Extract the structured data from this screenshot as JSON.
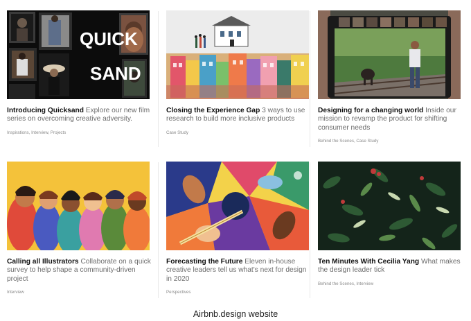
{
  "cards": [
    {
      "title": "Introducing Quicksand",
      "description": "Explore our new film series on overcoming creative adversity.",
      "tags": "Inspirations, Interview, Projects",
      "thumb_text": [
        "QUICK",
        "SAND"
      ]
    },
    {
      "title": "Closing the Experience Gap",
      "description": "3 ways to use research to build more inclusive products",
      "tags": "Case Study"
    },
    {
      "title": "Designing for a changing world",
      "description": "Inside our mission to revamp the product for shifting consumer needs",
      "tags": "Behind the Scenes, Case Study"
    },
    {
      "title": "Calling all Illustrators",
      "description": "Collaborate on a quick survey to help shape a community-driven project",
      "tags": "Interview"
    },
    {
      "title": "Forecasting the Future",
      "description": "Eleven in-house creative leaders tell us what's next for design in 2020",
      "tags": "Perspectives"
    },
    {
      "title": "Ten Minutes With Cecilia Yang",
      "description": "What makes the design leader tick",
      "tags": "Behind the Scenes, Interview"
    }
  ],
  "caption": "Airbnb.design website"
}
